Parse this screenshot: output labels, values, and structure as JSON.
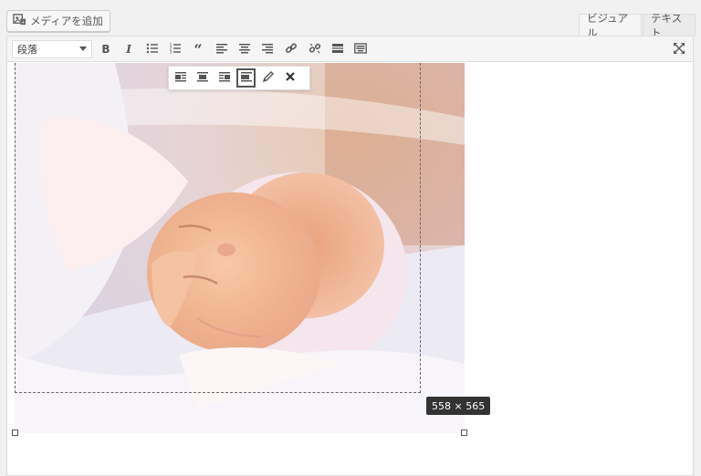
{
  "media_button": {
    "label": "メディアを追加",
    "icon": "media-add-icon"
  },
  "tabs": [
    {
      "label": "ビジュアル",
      "active": true
    },
    {
      "label": "テキスト",
      "active": false
    }
  ],
  "toolbar": {
    "format_select": "段落",
    "buttons": [
      "bold",
      "italic",
      "bulleted-list",
      "numbered-list",
      "blockquote",
      "align-left",
      "align-center",
      "align-right",
      "insert-link",
      "remove-link",
      "insert-more",
      "toolbar-toggle",
      "fullscreen"
    ]
  },
  "image_toolbar": {
    "buttons": [
      "align-left",
      "align-center",
      "align-right",
      "align-none",
      "edit",
      "remove"
    ],
    "active": "align-none"
  },
  "image": {
    "alt_subject": "sleeping newborn baby",
    "dimension_label": "558 × 565"
  }
}
